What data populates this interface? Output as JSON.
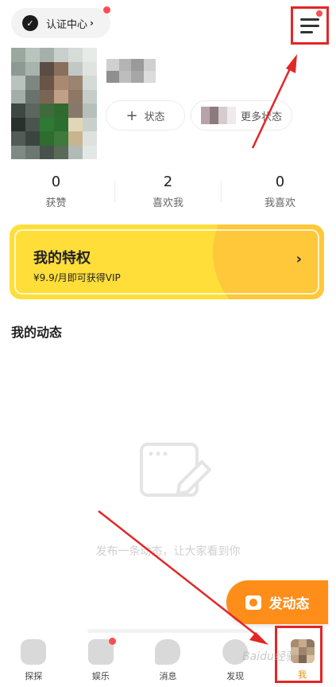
{
  "header": {
    "verify_label": "认证中心",
    "verify_chevron": "›",
    "verify_icon": "verified-badge-icon",
    "menu_icon": "hamburger-menu-icon"
  },
  "profile": {
    "status_chip_label": "状态",
    "status_chip_icon": "plus-icon",
    "more_status_label": "更多状态"
  },
  "stats": [
    {
      "value": "0",
      "label": "获赞"
    },
    {
      "value": "2",
      "label": "喜欢我"
    },
    {
      "value": "0",
      "label": "我喜欢"
    }
  ],
  "vip": {
    "title": "我的特权",
    "subtitle": "¥9.9/月即可获得VIP",
    "arrow": "›",
    "color": "#ffde3a"
  },
  "moments": {
    "title": "我的动态",
    "empty_text": "发布一条动态，让大家看到你",
    "empty_icon": "edit-post-icon"
  },
  "post_button": {
    "label": "发动态",
    "color": "#ff8d1a",
    "icon": "camera-icon"
  },
  "tabbar": {
    "items": [
      {
        "label": "探探",
        "icon": "discover-icon"
      },
      {
        "label": "娱乐",
        "icon": "video-play-icon"
      },
      {
        "label": "消息",
        "icon": "chat-bubble-icon"
      },
      {
        "label": "发现",
        "icon": "compass-icon"
      },
      {
        "label": "我",
        "icon": "me-avatar-icon"
      }
    ]
  },
  "watermark": "Baidu经验",
  "annotation_color": "#e32626"
}
